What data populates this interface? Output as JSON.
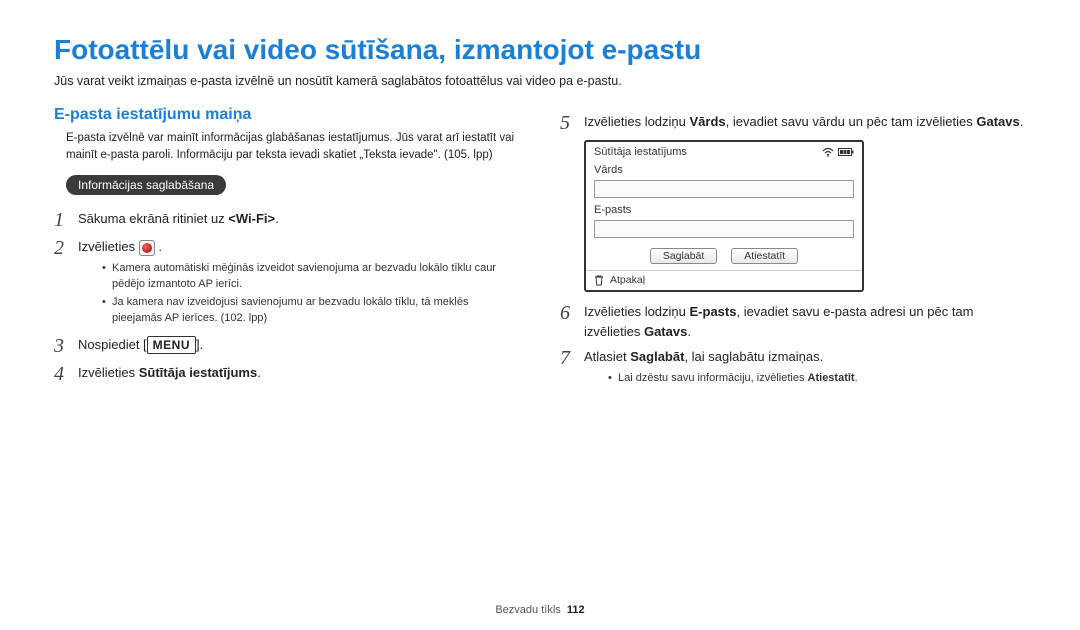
{
  "title": "Fotoattēlu vai video sūtīšana, izmantojot e-pastu",
  "intro": "Jūs varat veikt izmaiņas e-pasta izvēlnē un nosūtīt kamerā saglabātos fotoattēlus vai video pa e-pastu.",
  "left": {
    "section_title": "E-pasta iestatījumu maiņa",
    "section_desc": "E-pasta izvēlnē var mainīt informācijas glabāšanas iestatījumus. Jūs varat arī iestatīt vai mainīt e-pasta paroli. Informāciju par teksta ievadi skatiet „Teksta ievade\". (105. lpp)",
    "pill": "Informācijas saglabāšana",
    "step1_pre": "Sākuma ekrānā ritiniet uz ",
    "step1_bold": "<Wi-Fi>",
    "step1_post": ".",
    "step2": "Izvēlieties ",
    "step2_sub1": "Kamera automātiski mēģinās izveidot savienojuma ar bezvadu lokālo tīklu caur pēdējo izmantoto AP ierīci.",
    "step2_sub2": "Ja kamera nav izveidojusi savienojumu ar bezvadu lokālo tīklu, tā meklēs pieejamās AP ierīces. (102. lpp)",
    "step3_pre": "Nospiediet [",
    "step3_menu": "MENU",
    "step3_post": "].",
    "step4_pre": "Izvēlieties ",
    "step4_bold": "Sūtītāja iestatījums",
    "step4_post": "."
  },
  "right": {
    "step5_pre": "Izvēlieties lodziņu ",
    "step5_b1": "Vārds",
    "step5_mid": ", ievadiet savu vārdu un pēc tam izvēlieties ",
    "step5_b2": "Gatavs",
    "step5_post": ".",
    "device": {
      "header": "Sūtītāja iestatījums",
      "name_label": "Vārds",
      "email_label": "E-pasts",
      "save_btn": "Saglabāt",
      "reset_btn": "Atiestatīt",
      "back": "Atpakaļ"
    },
    "step6_pre": "Izvēlieties lodziņu ",
    "step6_b1": "E-pasts",
    "step6_mid": ", ievadiet savu e-pasta adresi un pēc tam izvēlieties ",
    "step6_b2": "Gatavs",
    "step6_post": ".",
    "step7_pre": "Atlasiet ",
    "step7_b1": "Saglabāt",
    "step7_post": ", lai saglabātu izmaiņas.",
    "step7_sub_pre": "Lai dzēstu savu informāciju, izvēlieties ",
    "step7_sub_bold": "Atiestatīt",
    "step7_sub_post": "."
  },
  "footer": {
    "label": "Bezvadu tīkls",
    "page": "112"
  }
}
